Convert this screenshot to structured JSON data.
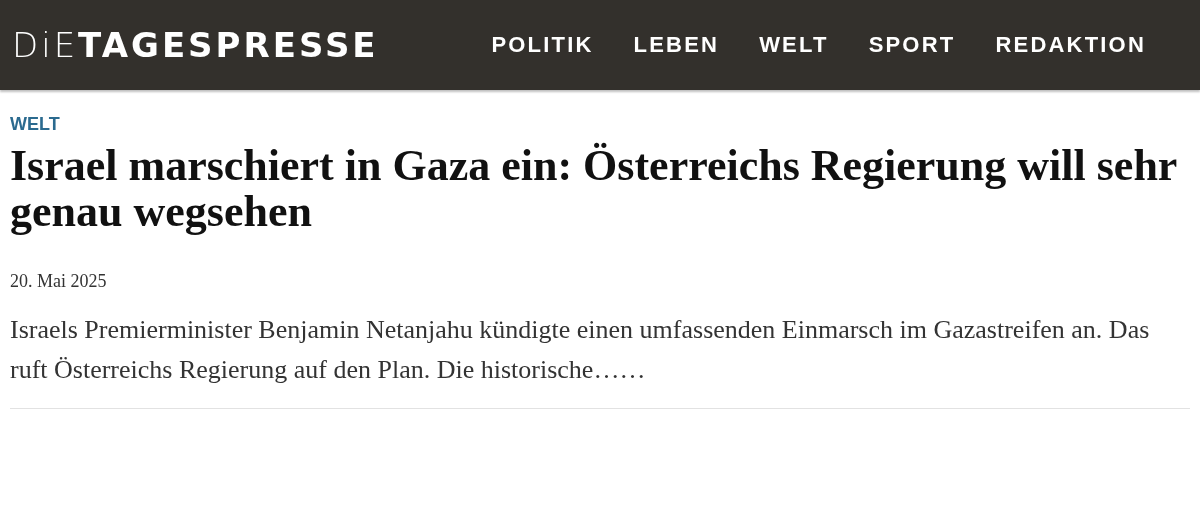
{
  "header": {
    "logo": {
      "light": "DiE",
      "bold": "TAGESPRESSE"
    },
    "nav": [
      {
        "label": "POLITIK"
      },
      {
        "label": "LEBEN"
      },
      {
        "label": "WELT"
      },
      {
        "label": "SPORT"
      },
      {
        "label": "REDAKTION"
      }
    ]
  },
  "article": {
    "category": "WELT",
    "title": "Israel marschiert in Gaza ein: Österreichs Regierung will sehr genau wegsehen",
    "date": "20. Mai 2025",
    "teaser": "Israels Premierminister Benjamin Netanjahu kündigte einen umfassenden Einmarsch im Gazastreifen an. Das ruft Österreichs Regierung auf den Plan. Die historische……"
  }
}
